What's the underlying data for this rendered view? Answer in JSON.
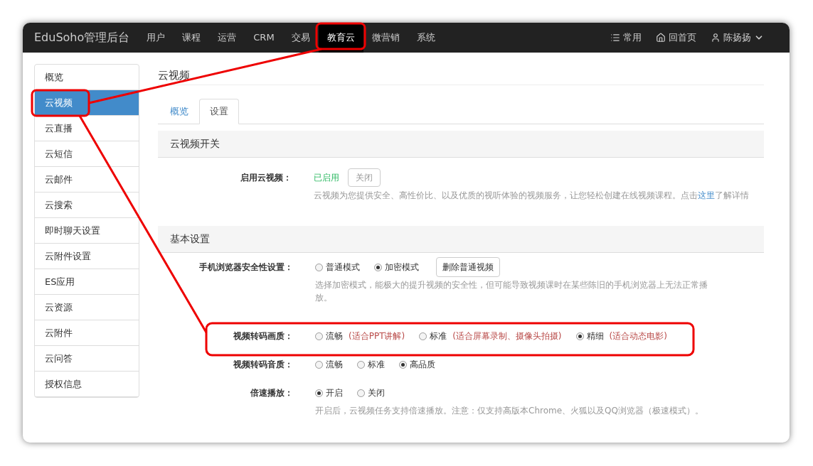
{
  "navbar": {
    "brand": "EduSoho管理后台",
    "items": [
      {
        "label": "用户",
        "selected": false
      },
      {
        "label": "课程",
        "selected": false
      },
      {
        "label": "运营",
        "selected": false
      },
      {
        "label": "CRM",
        "selected": false
      },
      {
        "label": "交易",
        "selected": false
      },
      {
        "label": "教育云",
        "selected": true
      },
      {
        "label": "微营销",
        "selected": false
      },
      {
        "label": "系统",
        "selected": false
      }
    ],
    "right": [
      {
        "kind": "list",
        "label": "常用"
      },
      {
        "kind": "home",
        "label": "回首页"
      },
      {
        "kind": "user",
        "label": "陈扬扬"
      }
    ]
  },
  "sidebar": {
    "items": [
      {
        "label": "概览",
        "selected": false
      },
      {
        "label": "云视频",
        "selected": true
      },
      {
        "label": "云直播",
        "selected": false
      },
      {
        "label": "云短信",
        "selected": false
      },
      {
        "label": "云邮件",
        "selected": false
      },
      {
        "label": "云搜索",
        "selected": false
      },
      {
        "label": "即时聊天设置",
        "selected": false
      },
      {
        "label": "云附件设置",
        "selected": false
      },
      {
        "label": "ES应用",
        "selected": false
      },
      {
        "label": "云资源",
        "selected": false
      },
      {
        "label": "云附件",
        "selected": false
      },
      {
        "label": "云问答",
        "selected": false
      },
      {
        "label": "授权信息",
        "selected": false
      }
    ]
  },
  "page_title": "云视频",
  "tabs": [
    {
      "label": "概览",
      "selected": false
    },
    {
      "label": "设置",
      "selected": true
    }
  ],
  "sections": [
    {
      "title": "云视频开关",
      "rows": [
        {
          "kind": "switch",
          "label": "启用云视频：",
          "status": "已启用",
          "button": "关闭",
          "help": "云视频为您提供安全、高性价比、以及优质的视听体验的视频服务，让您轻松创建在线视频课程。点击",
          "link": "这里",
          "help_after": "了解详情"
        }
      ]
    },
    {
      "title": "基本设置",
      "rows": [
        {
          "kind": "radio",
          "label": "手机浏览器安全性设置：",
          "options": [
            {
              "label": "普通模式",
              "selected": false
            },
            {
              "label": "加密模式",
              "selected": true
            }
          ],
          "button": "删除普通视频",
          "help": "选择加密模式，能极大的提升视频的安全性，但可能导致视频课时在某些陈旧的手机浏览器上无法正常播放。"
        },
        {
          "kind": "radio",
          "label": "视频转码画质：",
          "options": [
            {
              "label": "流畅",
              "note": "(适合PPT讲解)",
              "selected": false
            },
            {
              "label": "标准",
              "note": "(适合屏幕录制、摄像头拍摄)",
              "selected": false
            },
            {
              "label": "精细",
              "note": "(适合动态电影)",
              "selected": true
            }
          ]
        },
        {
          "kind": "radio",
          "label": "视频转码音质：",
          "options": [
            {
              "label": "流畅",
              "selected": false
            },
            {
              "label": "标准",
              "selected": false
            },
            {
              "label": "高品质",
              "selected": true
            }
          ]
        },
        {
          "kind": "radio",
          "label": "倍速播放：",
          "options": [
            {
              "label": "开启",
              "selected": true
            },
            {
              "label": "关闭",
              "selected": false
            }
          ],
          "help": "开启后，云视频任务支持倍速播放。注意：仅支持高版本Chrome、火狐以及QQ浏览器（极速模式）。"
        }
      ]
    }
  ]
}
